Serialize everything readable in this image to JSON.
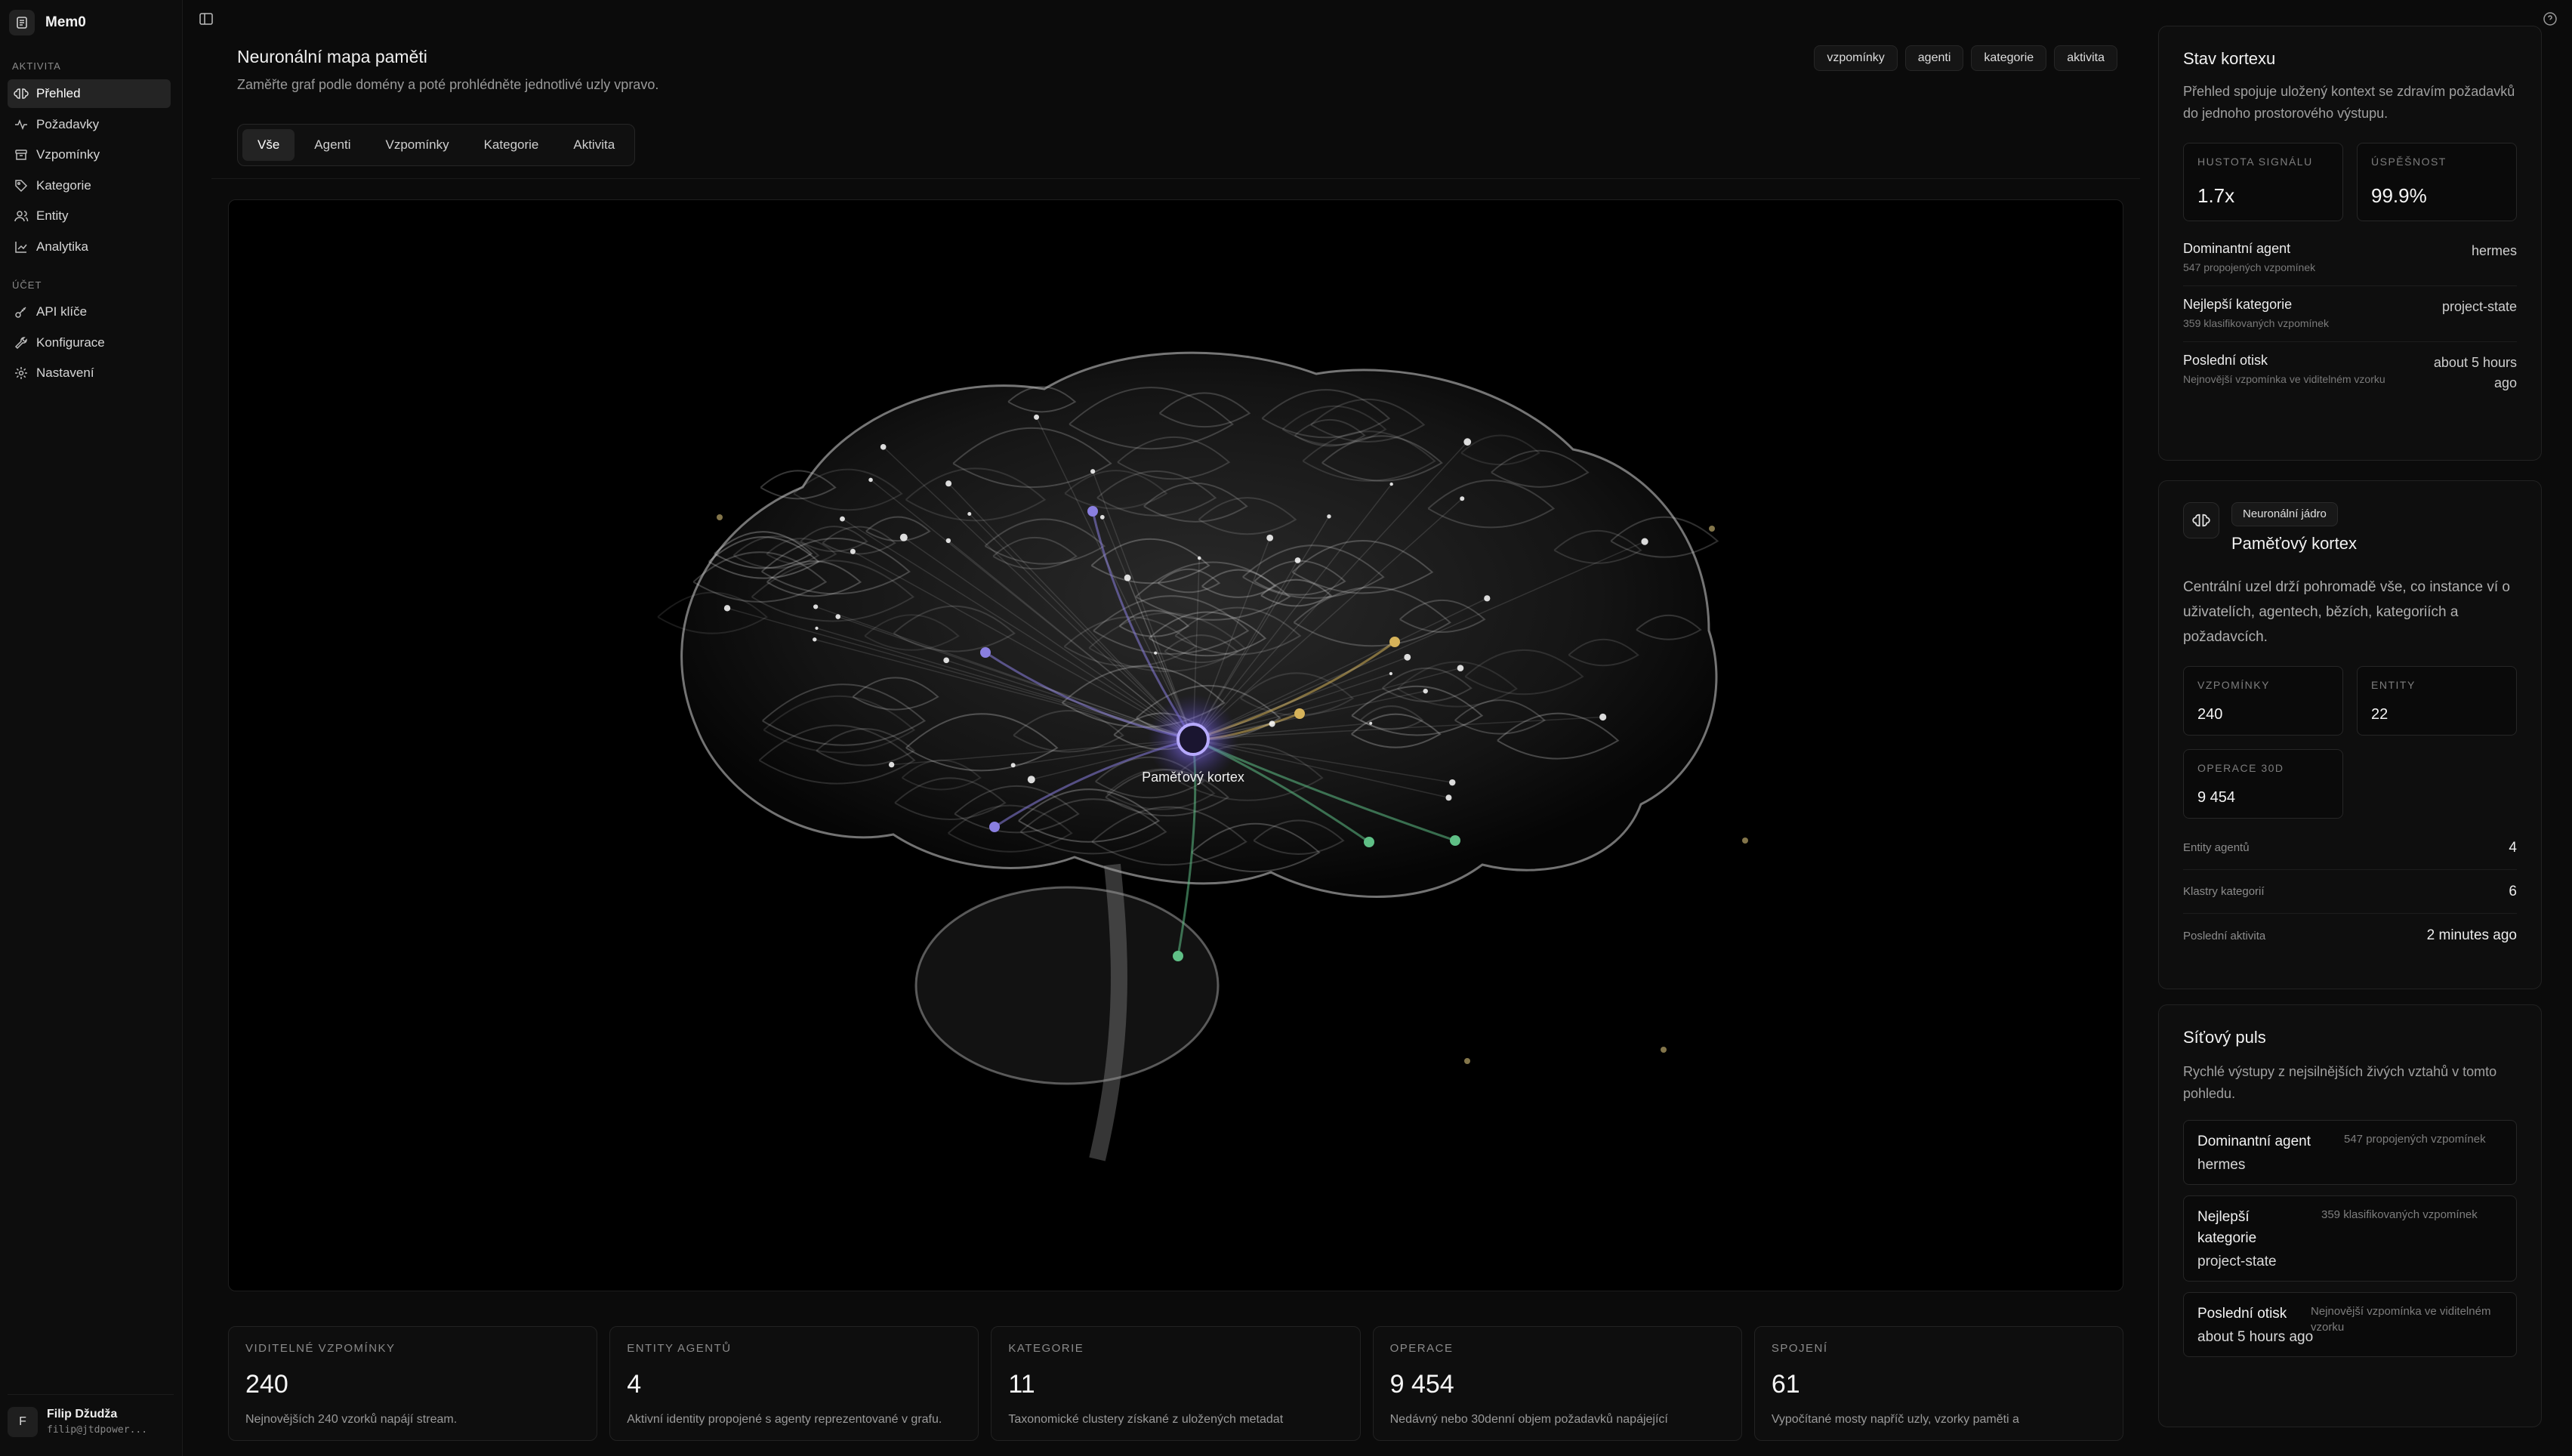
{
  "app": {
    "name": "Mem0"
  },
  "sidebar": {
    "section_activity": "AKTIVITA",
    "section_account": "ÚČET",
    "items_activity": [
      {
        "label": "Přehled",
        "icon": "brain-icon",
        "active": true
      },
      {
        "label": "Požadavky",
        "icon": "activity-icon"
      },
      {
        "label": "Vzpomínky",
        "icon": "archive-icon"
      },
      {
        "label": "Kategorie",
        "icon": "tag-icon"
      },
      {
        "label": "Entity",
        "icon": "users-icon"
      },
      {
        "label": "Analytika",
        "icon": "chart-icon"
      }
    ],
    "items_account": [
      {
        "label": "API klíče",
        "icon": "key-icon"
      },
      {
        "label": "Konfigurace",
        "icon": "wrench-icon"
      },
      {
        "label": "Nastavení",
        "icon": "gear-icon"
      }
    ],
    "user": {
      "initial": "F",
      "name": "Filip Džudža",
      "email": "filip@jtdpower..."
    }
  },
  "map": {
    "title": "Neuronální mapa paměti",
    "subtitle": "Zaměřte graf podle domény a poté prohlédněte jednotlivé uzly vpravo.",
    "chips": [
      "vzpomínky",
      "agenti",
      "kategorie",
      "aktivita"
    ],
    "tabs": [
      {
        "label": "Vše",
        "active": true
      },
      {
        "label": "Agenti"
      },
      {
        "label": "Vzpomínky"
      },
      {
        "label": "Kategorie"
      },
      {
        "label": "Aktivita"
      }
    ],
    "core_label": "Paměťový kortex",
    "colors": {
      "core": "#8b7cf6",
      "agents": "#8a7fe0",
      "categories": "#d6b35a",
      "activity": "#5fbf86"
    }
  },
  "stats": [
    {
      "label": "VIDITELNÉ VZPOMÍNKY",
      "value": "240",
      "desc": "Nejnovějších 240 vzorků napájí stream."
    },
    {
      "label": "ENTITY AGENTŮ",
      "value": "4",
      "desc": "Aktivní identity propojené s agenty reprezentované v grafu."
    },
    {
      "label": "KATEGORIE",
      "value": "11",
      "desc": "Taxonomické clustery získané z uložených metadat"
    },
    {
      "label": "OPERACE",
      "value": "9 454",
      "desc": "Nedávný nebo 30denní objem požadavků napájející"
    },
    {
      "label": "SPOJENÍ",
      "value": "61",
      "desc": "Vypočítané mosty napříč uzly, vzorky paměti a"
    }
  ],
  "cortex_state": {
    "title": "Stav kortexu",
    "desc": "Přehled spojuje uložený kontext se zdravím požadavků do jednoho prostorového výstupu.",
    "signal_density_label": "HUSTOTA SIGNÁLU",
    "signal_density": "1.7x",
    "success_label": "ÚSPĚŠNOST",
    "success": "99.9%",
    "dominant_agent_label": "Dominantní agent",
    "dominant_agent_sub": "547 propojených vzpomínek",
    "dominant_agent": "hermes",
    "top_category_label": "Nejlepší kategorie",
    "top_category_sub": "359 klasifikovaných vzpomínek",
    "top_category": "project-state",
    "last_print_label": "Poslední otisk",
    "last_print_sub": "Nejnovější vzpomínka ve viditelném vzorku",
    "last_print": "about 5 hours ago"
  },
  "core": {
    "badge": "Neuronální jádro",
    "title": "Paměťový kortex",
    "desc": "Centrální uzel drží pohromadě vše, co instance ví o uživatelích, agentech, bězích, kategoriích a požadavcích.",
    "memories_label": "VZPOMÍNKY",
    "memories": "240",
    "entities_label": "ENTITY",
    "entities": "22",
    "ops_label": "OPERACE 30D",
    "ops": "9 454",
    "agent_entities_label": "Entity agentů",
    "agent_entities": "4",
    "category_clusters_label": "Klastry kategorií",
    "category_clusters": "6",
    "last_activity_label": "Poslední aktivita",
    "last_activity": "2 minutes ago"
  },
  "pulse": {
    "title": "Síťový puls",
    "desc": "Rychlé výstupy z nejsilnějších živých vztahů v tomto pohledu.",
    "items": [
      {
        "title": "Dominantní agent",
        "value": "hermes",
        "note": "547 propojených vzpomínek"
      },
      {
        "title": "Nejlepší kategorie",
        "value": "project-state",
        "note": "359 klasifikovaných vzpomínek"
      },
      {
        "title": "Poslední otisk",
        "value": "about 5 hours ago",
        "note": "Nejnovější vzpomínka ve viditelném vzorku"
      }
    ]
  }
}
